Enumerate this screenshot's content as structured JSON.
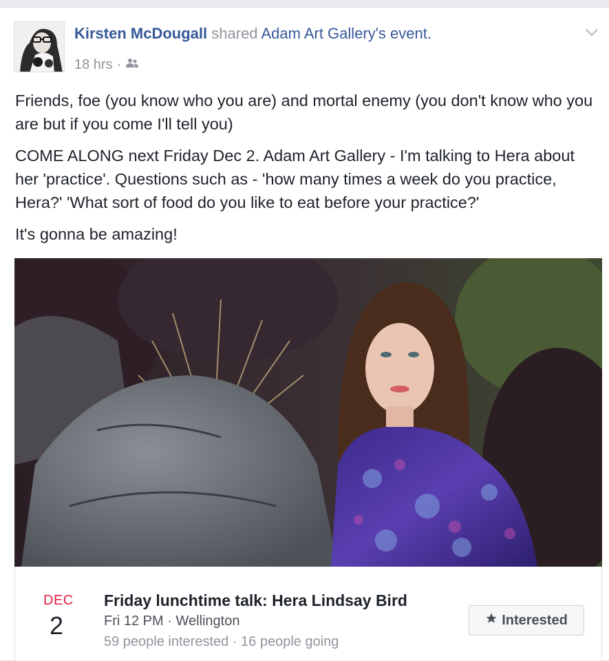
{
  "post": {
    "author": "Kirsten McDougall",
    "action": "shared",
    "shared_page": "Adam Art Gallery",
    "shared_suffix": "'s event.",
    "time": "18 hrs",
    "separator": "·",
    "audience_icon": "friends-icon",
    "menu_icon": "chevron-down-icon",
    "paragraphs": [
      "Friends, foe (you know who you are) and mortal enemy (you don't know who you are but if you come I'll tell you)",
      "COME ALONG next Friday Dec 2. Adam Art Gallery - I'm talking to Hera about her 'practice'. Questions such as - 'how many times a week do you practice, Hera?' 'What sort of food do you like to eat before your practice?'",
      "It's gonna be amazing!"
    ]
  },
  "event": {
    "month": "DEC",
    "day": "2",
    "title": "Friday lunchtime talk: Hera Lindsay Bird",
    "when": "Fri 12 PM · Wellington",
    "stats": "59 people interested · 16 people going",
    "button_label": "Interested",
    "button_icon": "star-icon"
  },
  "colors": {
    "link": "#365899",
    "date_red": "#e41e3f",
    "text": "#1d2129",
    "muted": "#90949c"
  }
}
